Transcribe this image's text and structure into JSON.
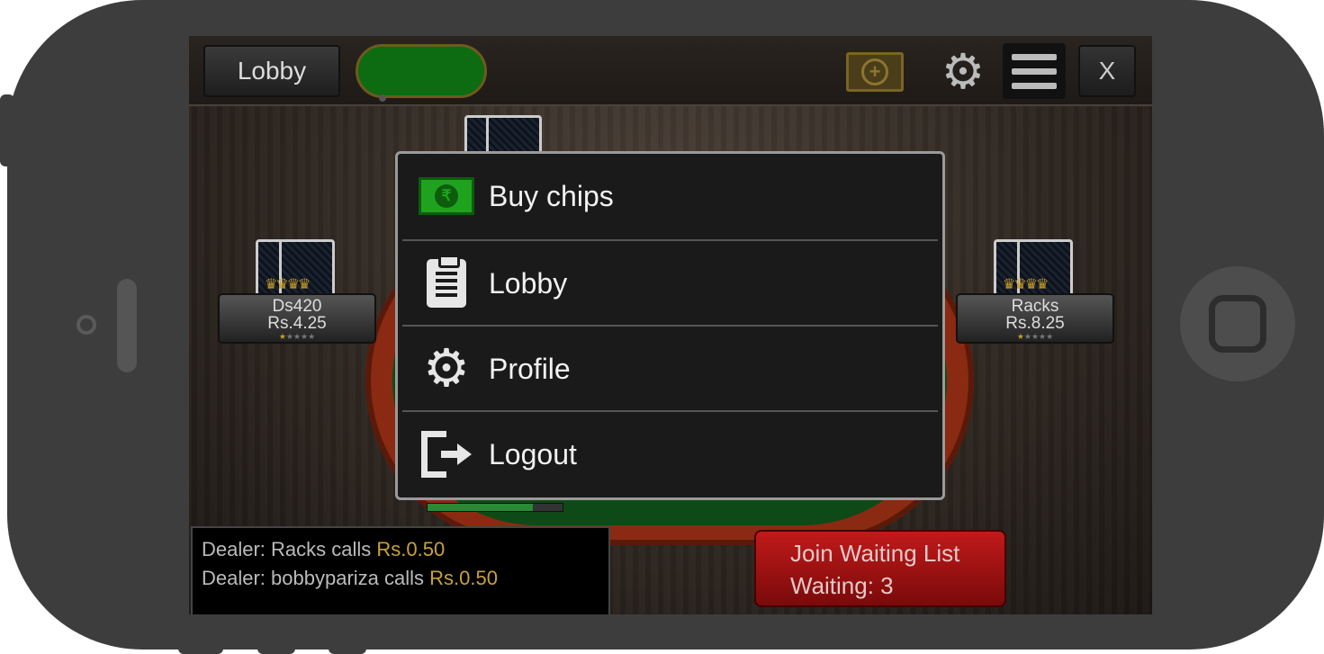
{
  "topbar": {
    "lobby_label": "Lobby",
    "close_label": "X",
    "cash_symbol": "+"
  },
  "players": [
    {
      "name": "Ds420",
      "balance": "Rs.4.25",
      "rating": 1,
      "rating_max": 5
    },
    {
      "name": "Racks",
      "balance": "Rs.8.25",
      "rating": 1,
      "rating_max": 5
    }
  ],
  "menu": {
    "items": [
      {
        "label": "Buy chips",
        "icon": "cash-icon",
        "symbol": "₹"
      },
      {
        "label": "Lobby",
        "icon": "clipboard-icon"
      },
      {
        "label": "Profile",
        "icon": "gear-icon"
      },
      {
        "label": "Logout",
        "icon": "logout-icon"
      }
    ]
  },
  "chat": {
    "lines": [
      {
        "text": "Dealer: Racks calls ",
        "amount": "Rs.0.50"
      },
      {
        "text": "Dealer: bobbypariza calls ",
        "amount": "Rs.0.50"
      }
    ]
  },
  "waiting_list": {
    "button_label": "Join Waiting List",
    "waiting_text": "Waiting: 3"
  },
  "timer_progress": 0.78,
  "colors": {
    "accent_green": "#1fa31f",
    "join_red": "#c11a1a",
    "amount_gold": "#c8a23a"
  }
}
